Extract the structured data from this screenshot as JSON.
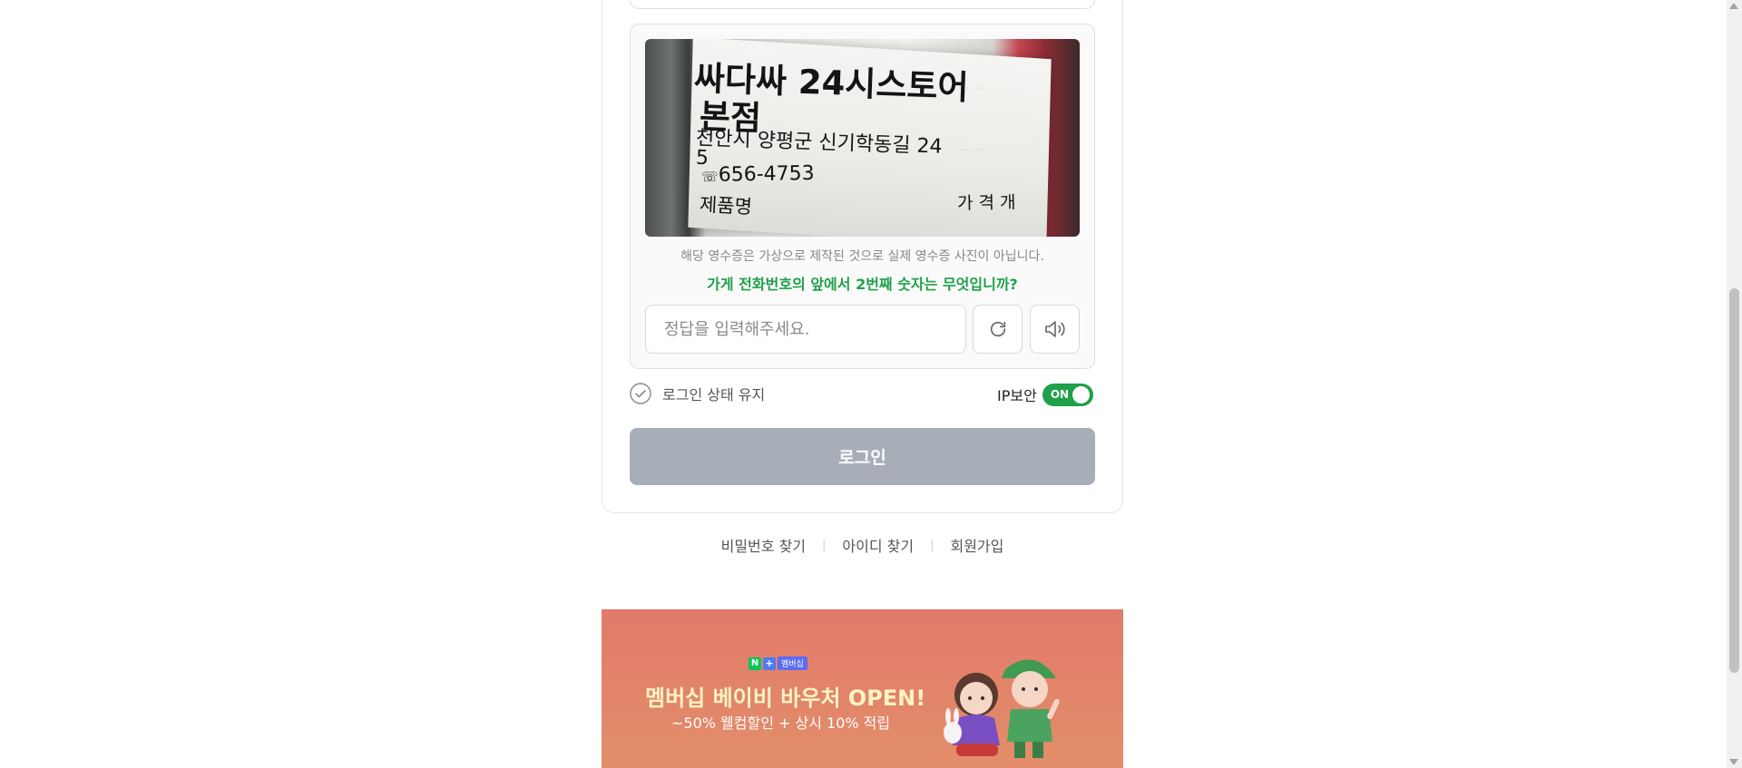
{
  "captcha": {
    "receipt": {
      "store_name_line1": "싸다싸 24시스토어",
      "store_name_line2": "본점",
      "address_line1": "천안시 양평군 신기학동길 24",
      "address_line2": "5",
      "phone": "656-4753",
      "column_product": "제품명",
      "column_price_qty": "가 격    개"
    },
    "notice": "해당 영수증은 가상으로 제작된 것으로 실제 영수증 사진이 아닙니다.",
    "question": "가게 전화번호의 앞에서 2번째 숫자는 무엇입니까?",
    "answer": {
      "placeholder": "정답을 입력해주세요.",
      "value": ""
    },
    "refresh_icon": "refresh-icon",
    "sound_icon": "speaker-icon"
  },
  "keep_login": {
    "label": "로그인 상태 유지",
    "checked": false
  },
  "ip_security": {
    "label": "IP보안",
    "toggle_text": "ON",
    "enabled": true
  },
  "login_button": "로그인",
  "footer_links": [
    {
      "label": "비밀번호 찾기"
    },
    {
      "label": "아이디 찾기"
    },
    {
      "label": "회원가입"
    }
  ],
  "footer_separator": "|",
  "banner": {
    "brand_n": "N",
    "brand_plus": "+",
    "brand_tag": "멤버십",
    "headline": "멤버십 베이비 바우처 OPEN!",
    "subline": "~50% 웰컴할인 + 상시 10% 적립"
  },
  "colors": {
    "accent_green": "#1fa049",
    "login_button_disabled": "#a8aeb8",
    "banner_bg": "#e17a6b"
  }
}
